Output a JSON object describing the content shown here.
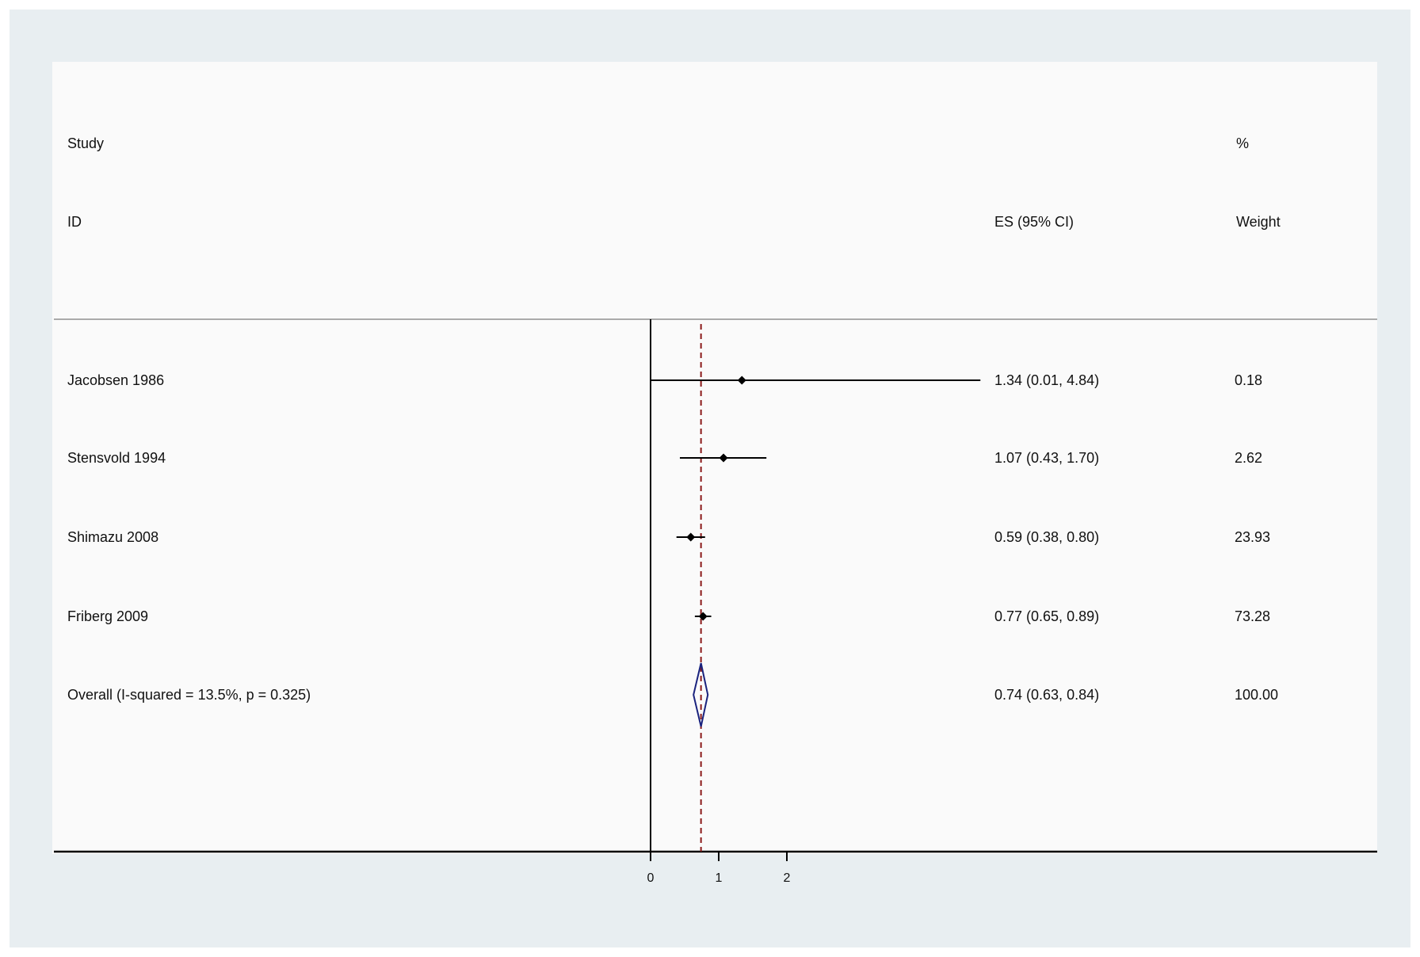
{
  "header": {
    "study_line1": "Study",
    "study_line2": "ID",
    "es_header": "ES (95% CI)",
    "weight_line1": "%",
    "weight_line2": "Weight"
  },
  "colors": {
    "outer_frame": "#e8eef1",
    "panel": "#fafafa",
    "point_and_ci": "#000000",
    "pooled_diamond": "#1a237e",
    "reference_line": "#8b1a1a",
    "separator": "#aaaaaa"
  },
  "chart_data": {
    "type": "forest",
    "x_ticks": [
      "0",
      "1",
      "2"
    ],
    "xlim": [
      0,
      4.84
    ],
    "null_line": 0,
    "pooled_line": 0.74,
    "studies": [
      {
        "label": "Jacobsen 1986",
        "es": 1.34,
        "lo": 0.01,
        "hi": 4.84,
        "ci_text": "1.34 (0.01, 4.84)",
        "weight": "0.18"
      },
      {
        "label": "Stensvold 1994",
        "es": 1.07,
        "lo": 0.43,
        "hi": 1.7,
        "ci_text": "1.07 (0.43, 1.70)",
        "weight": "2.62"
      },
      {
        "label": "Shimazu 2008",
        "es": 0.59,
        "lo": 0.38,
        "hi": 0.8,
        "ci_text": "0.59 (0.38, 0.80)",
        "weight": "23.93"
      },
      {
        "label": "Friberg 2009",
        "es": 0.77,
        "lo": 0.65,
        "hi": 0.89,
        "ci_text": "0.77 (0.65, 0.89)",
        "weight": "73.28"
      }
    ],
    "overall": {
      "label": "Overall  (I-squared = 13.5%, p = 0.325)",
      "es": 0.74,
      "lo": 0.63,
      "hi": 0.84,
      "ci_text": "0.74 (0.63, 0.84)",
      "weight": "100.00"
    }
  }
}
